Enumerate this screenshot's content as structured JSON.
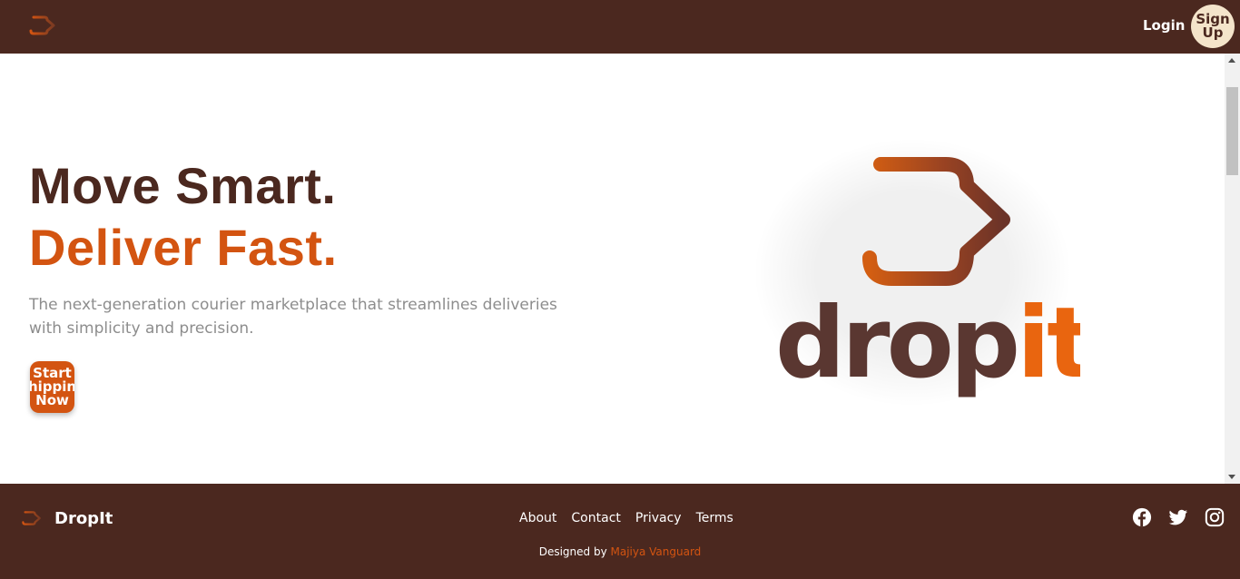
{
  "nav": {
    "brand_icon": "dropit-logo-icon",
    "login_label": "Login",
    "signup_label": "Sign Up"
  },
  "hero": {
    "headline_line1": "Move Smart.",
    "headline_line2": "Deliver Fast.",
    "subtitle": "The next-generation courier marketplace that streamlines deliveries with simplicity and precision.",
    "cta_label": "Start Shipping Now",
    "logo_word_part1": "drop",
    "logo_word_part2": "it"
  },
  "footer": {
    "brand": "DropIt",
    "links": [
      "About",
      "Contact",
      "Privacy",
      "Terms"
    ],
    "credit_prefix": "Designed by",
    "credit_name": "Majiya Vanguard",
    "social_icons": [
      "facebook-icon",
      "twitter-icon",
      "instagram-icon"
    ]
  },
  "colors": {
    "brand_brown": "#4b281f",
    "accent_orange": "#d35411",
    "cream": "#f4e4ca",
    "subtitle_gray": "#8d8d8d",
    "logo_brown": "#5a3731",
    "logo_orange": "#e9650f"
  }
}
